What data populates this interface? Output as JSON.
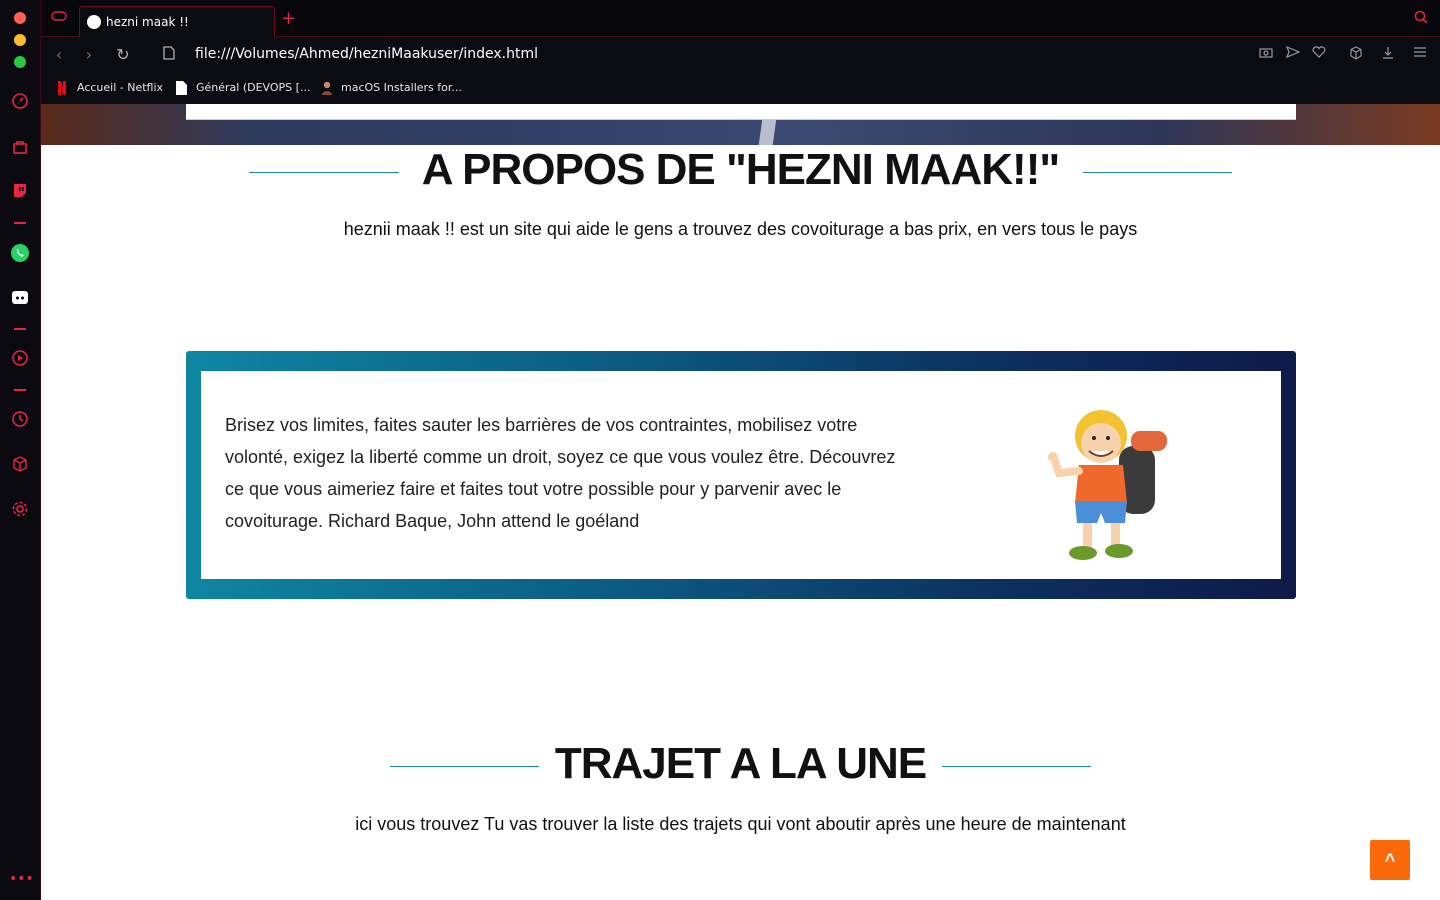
{
  "browser": {
    "tab_title": "hezni maak !!",
    "url": "file:///Volumes/Ahmed/hezniMaakuser/index.html",
    "bookmarks": [
      {
        "label": "Accueil - Netflix",
        "icon": "netflix-icon"
      },
      {
        "label": "Général (DEVOPS [...",
        "icon": "document-icon"
      },
      {
        "label": "macOS Installers for...",
        "icon": "avatar-icon"
      }
    ],
    "accent_color": "#e32645"
  },
  "about": {
    "title": "A PROPOS DE \"HEZNI MAAK!!\"",
    "subtitle": "heznii maak !! est un site qui aide le gens a trouvez des covoiturage a bas prix, en vers tous le pays"
  },
  "promo": {
    "text": "Brisez vos limites, faites sauter les barrières de vos contraintes, mobilisez votre volonté, exigez la liberté comme un droit, soyez ce que vous voulez être. Découvrez ce que vous aimeriez faire et faites tout votre possible pour y parvenir avec le covoiturage. Richard Baque, John attend le goéland"
  },
  "featured": {
    "title": "TRAJET A LA UNE",
    "subtitle": "ici vous trouvez Tu vas trouver la liste des trajets qui vont aboutir après une heure de maintenant"
  },
  "back_to_top": {
    "label": "^",
    "color": "#fb6a0a"
  }
}
